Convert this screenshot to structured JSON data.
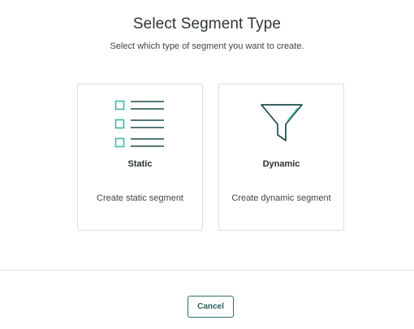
{
  "dialog": {
    "title": "Select Segment Type",
    "subtitle": "Select which type of segment you want to create."
  },
  "options": [
    {
      "label": "Static",
      "description": "Create static segment",
      "icon": "list-checkbox-icon"
    },
    {
      "label": "Dynamic",
      "description": "Create dynamic segment",
      "icon": "funnel-icon"
    }
  ],
  "footer": {
    "cancel_label": "Cancel"
  },
  "colors": {
    "accent": "#3fb8a0",
    "icon_dark": "#1f4a4a",
    "button_border": "#2f6e6e"
  }
}
